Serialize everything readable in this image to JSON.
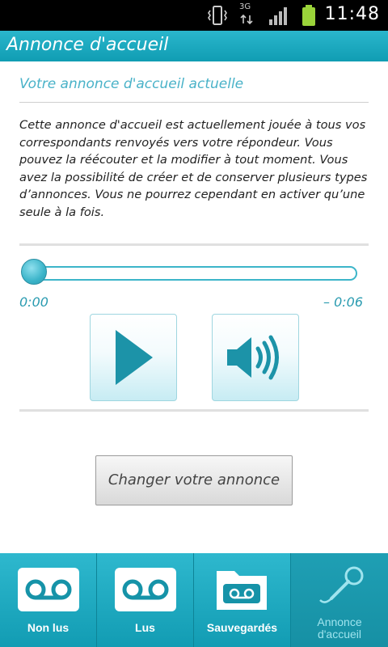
{
  "status_bar": {
    "time": "11:48",
    "network": "3G",
    "icons": [
      "vibrate-icon",
      "network-3g-icon",
      "signal-icon",
      "battery-icon"
    ]
  },
  "title_bar": {
    "title": "Annonce d'accueil"
  },
  "section": {
    "title": "Votre annonce d'accueil actuelle",
    "description": "Cette annonce d'accueil est actuellement jouée à tous vos correspondants renvoyés vers votre répondeur. Vous pouvez la réécouter et la modifier à tout moment. Vous avez la possibilité de créer et de conserver plusieurs types d’annonces. Vous ne pourrez cependant en activer qu’une seule à la fois."
  },
  "player": {
    "elapsed": "0:00",
    "remaining": "– 0:06",
    "progress": 0,
    "play_icon": "play-icon",
    "volume_icon": "speaker-volume-icon"
  },
  "actions": {
    "change_label": "Changer votre annonce"
  },
  "tabs": [
    {
      "label": "Non lus",
      "icon": "voicemail-icon",
      "active": false
    },
    {
      "label": "Lus",
      "icon": "voicemail-icon",
      "active": false
    },
    {
      "label": "Sauvegardés",
      "icon": "saved-folder-icon",
      "active": false
    },
    {
      "label": "Annonce d'accueil",
      "icon": "microphone-icon",
      "active": true
    }
  ],
  "colors": {
    "accent": "#2ab6cc",
    "accent_dark": "#109db3",
    "text": "#222222"
  }
}
